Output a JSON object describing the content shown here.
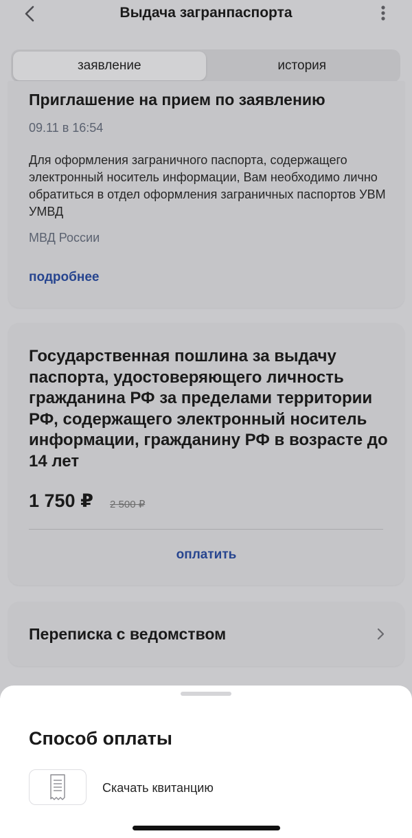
{
  "header": {
    "title": "Выдача загранпаспорта",
    "back_icon": "chevron-left-icon",
    "more_icon": "more-vertical-icon"
  },
  "tabs": [
    {
      "label": "заявление",
      "active": true
    },
    {
      "label": "история",
      "active": false
    }
  ],
  "invitation_card": {
    "title": "Приглашение на прием по заявлению",
    "date": "09.11 в 16:54",
    "text": "Для оформления заграничного паспорта, содержащего электронный носитель информации, Вам необходимо лично обратиться в отдел оформления заграничных паспортов УВМ УМВД",
    "department": "МВД России",
    "more_link": "подробнее"
  },
  "fee_card": {
    "title": "Государственная пошлина за выдачу паспорта, удостоверяющего личность гражданина РФ за пределами территории РФ, содержащего электронный носитель информации, гражданину РФ в возрасте до 14 лет",
    "price": "1 750 ₽",
    "old_price": "2 500 ₽",
    "pay_button": "оплатить"
  },
  "correspondence_card": {
    "title": "Переписка с ведомством",
    "chevron_icon": "chevron-right-icon"
  },
  "payment_sheet": {
    "title": "Способ оплаты",
    "option_icon": "receipt-icon",
    "option_label": "Скачать квитанцию"
  },
  "colors": {
    "link": "#27458f",
    "overlay_background": "#c9c9cc",
    "sheet_background": "#ffffff"
  }
}
